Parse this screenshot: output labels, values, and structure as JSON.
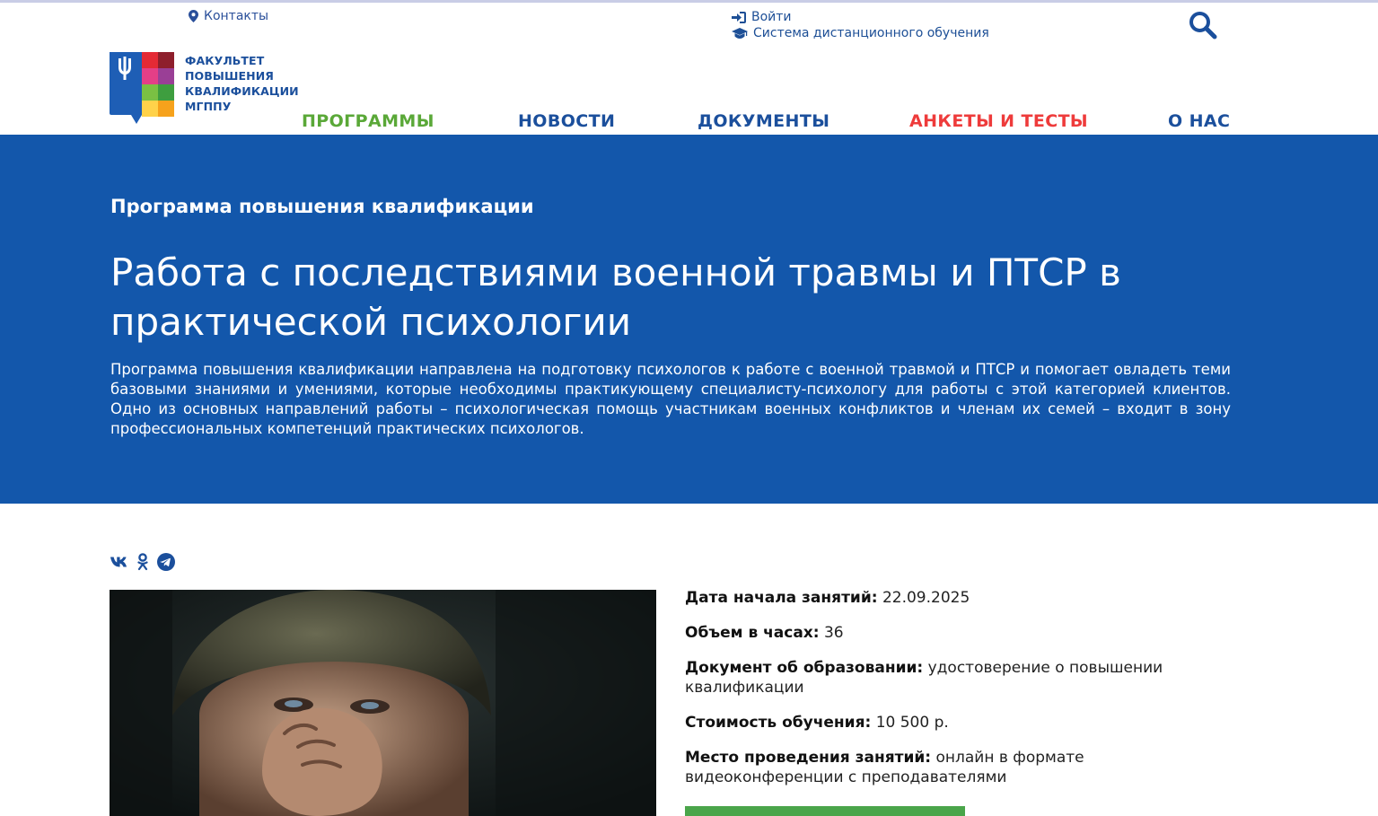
{
  "header": {
    "contacts_label": "Контакты",
    "login_label": "Войти",
    "lms_label": "Система дистанционного обучения",
    "search_icon": "search-icon"
  },
  "logo": {
    "lines": [
      "ФАКУЛЬТЕТ",
      "ПОВЫШЕНИЯ",
      "КВАЛИФИКАЦИИ",
      "МГППУ"
    ]
  },
  "nav": {
    "programs": "ПРОГРАММЫ",
    "news": "НОВОСТИ",
    "documents": "ДОКУМЕНТЫ",
    "surveys": "АНКЕТЫ И ТЕСТЫ",
    "about": "О НАС"
  },
  "hero": {
    "kicker": "Программа повышения квалификации",
    "title": "Работа с последствиями военной травмы и ПТСР в практической психологии",
    "description": "Программа повышения квалификации направлена на подготовку психологов к работе с военной травмой и ПТСР и помогает овладеть теми базовыми знаниями и умениями, которые необходимы практикующему специалисту-психологу для работы с этой категорией клиентов. Одно из основных направлений работы – психологическая помощь участникам военных конфликтов и членам их семей – входит в зону профессиональных компетенций практических психологов."
  },
  "share": {
    "icons": [
      "vk-icon",
      "odnoklassniki-icon",
      "telegram-icon"
    ]
  },
  "details": {
    "start_label": "Дата начала занятий:",
    "start_value": "22.09.2025",
    "hours_label": "Объем в часах:",
    "hours_value": "36",
    "document_label": "Документ об образовании:",
    "document_value": "удостоверение о повышении квалификации",
    "price_label": "Стоимость обучения:",
    "price_value": "10 500 р.",
    "place_label": "Место проведения занятий:",
    "place_value": "онлайн в формате видеоконференции с преподавателями"
  },
  "colors": {
    "brand_blue": "#1357ab",
    "nav_green": "#5aa838",
    "nav_red": "#ee3b3b",
    "button_green": "#4aa54a"
  }
}
